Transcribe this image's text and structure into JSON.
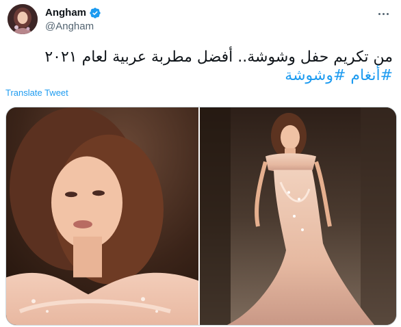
{
  "tweet": {
    "author": {
      "display_name": "Angham",
      "handle": "@Angham",
      "verified": true,
      "avatar_icon": "profile-avatar"
    },
    "more_icon": "more-options-icon",
    "text_lines": [
      "من تكريم حفل وشوشة.. أفضل مطربة عربية لعام ٢٠٢١"
    ],
    "hashtags": [
      "#أنغام",
      "#وشوشة"
    ],
    "translate_label": "Translate Tweet",
    "media": [
      {
        "icon": "photo-portrait-closeup"
      },
      {
        "icon": "photo-full-gown"
      }
    ]
  },
  "colors": {
    "link": "#1d9bf0",
    "verified_badge": "#1d9bf0",
    "text": "#0f1419",
    "secondary_text": "#536471"
  }
}
